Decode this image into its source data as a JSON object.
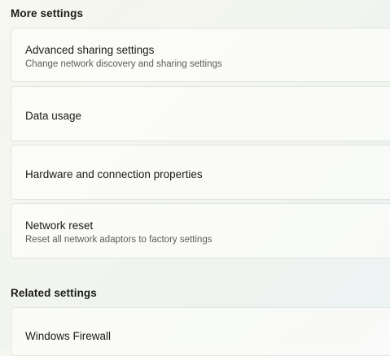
{
  "more_settings": {
    "header": "More settings",
    "items": [
      {
        "title": "Advanced sharing settings",
        "subtitle": "Change network discovery and sharing settings"
      },
      {
        "title": "Data usage"
      },
      {
        "title": "Hardware and connection properties"
      },
      {
        "title": "Network reset",
        "subtitle": "Reset all network adaptors to factory settings"
      }
    ]
  },
  "related_settings": {
    "header": "Related settings",
    "items": [
      {
        "title": "Windows Firewall"
      }
    ]
  }
}
